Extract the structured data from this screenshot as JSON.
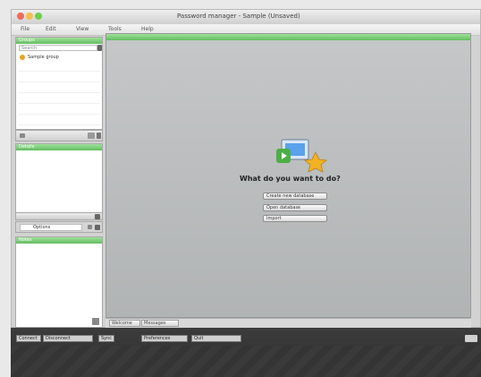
{
  "window": {
    "title": "Password manager - Sample (Unsaved)",
    "menu": [
      "File",
      "Edit",
      "View",
      "Tools",
      "Help"
    ]
  },
  "sidebar": {
    "top_panel": {
      "header": "Groups",
      "search_placeholder": "Search",
      "selected_item": "Sample group"
    },
    "middle_panel": {
      "header": "Details"
    },
    "bottom_panel": {
      "header": "Notes",
      "field_value": "Options"
    }
  },
  "main": {
    "question": "What do you want to do?",
    "actions": [
      "Create new database",
      "Open database",
      "Import"
    ]
  },
  "tabs": [
    "Welcome",
    "Messages"
  ],
  "bottom_bar": {
    "buttons": [
      "Connect",
      "Disconnect",
      "Sync",
      "Preferences",
      "Quit"
    ]
  },
  "colors": {
    "accent_green": "#63bd61",
    "traffic_red": "#ef6b5b",
    "traffic_yellow": "#f3c04f",
    "traffic_green": "#6ccf4b"
  }
}
